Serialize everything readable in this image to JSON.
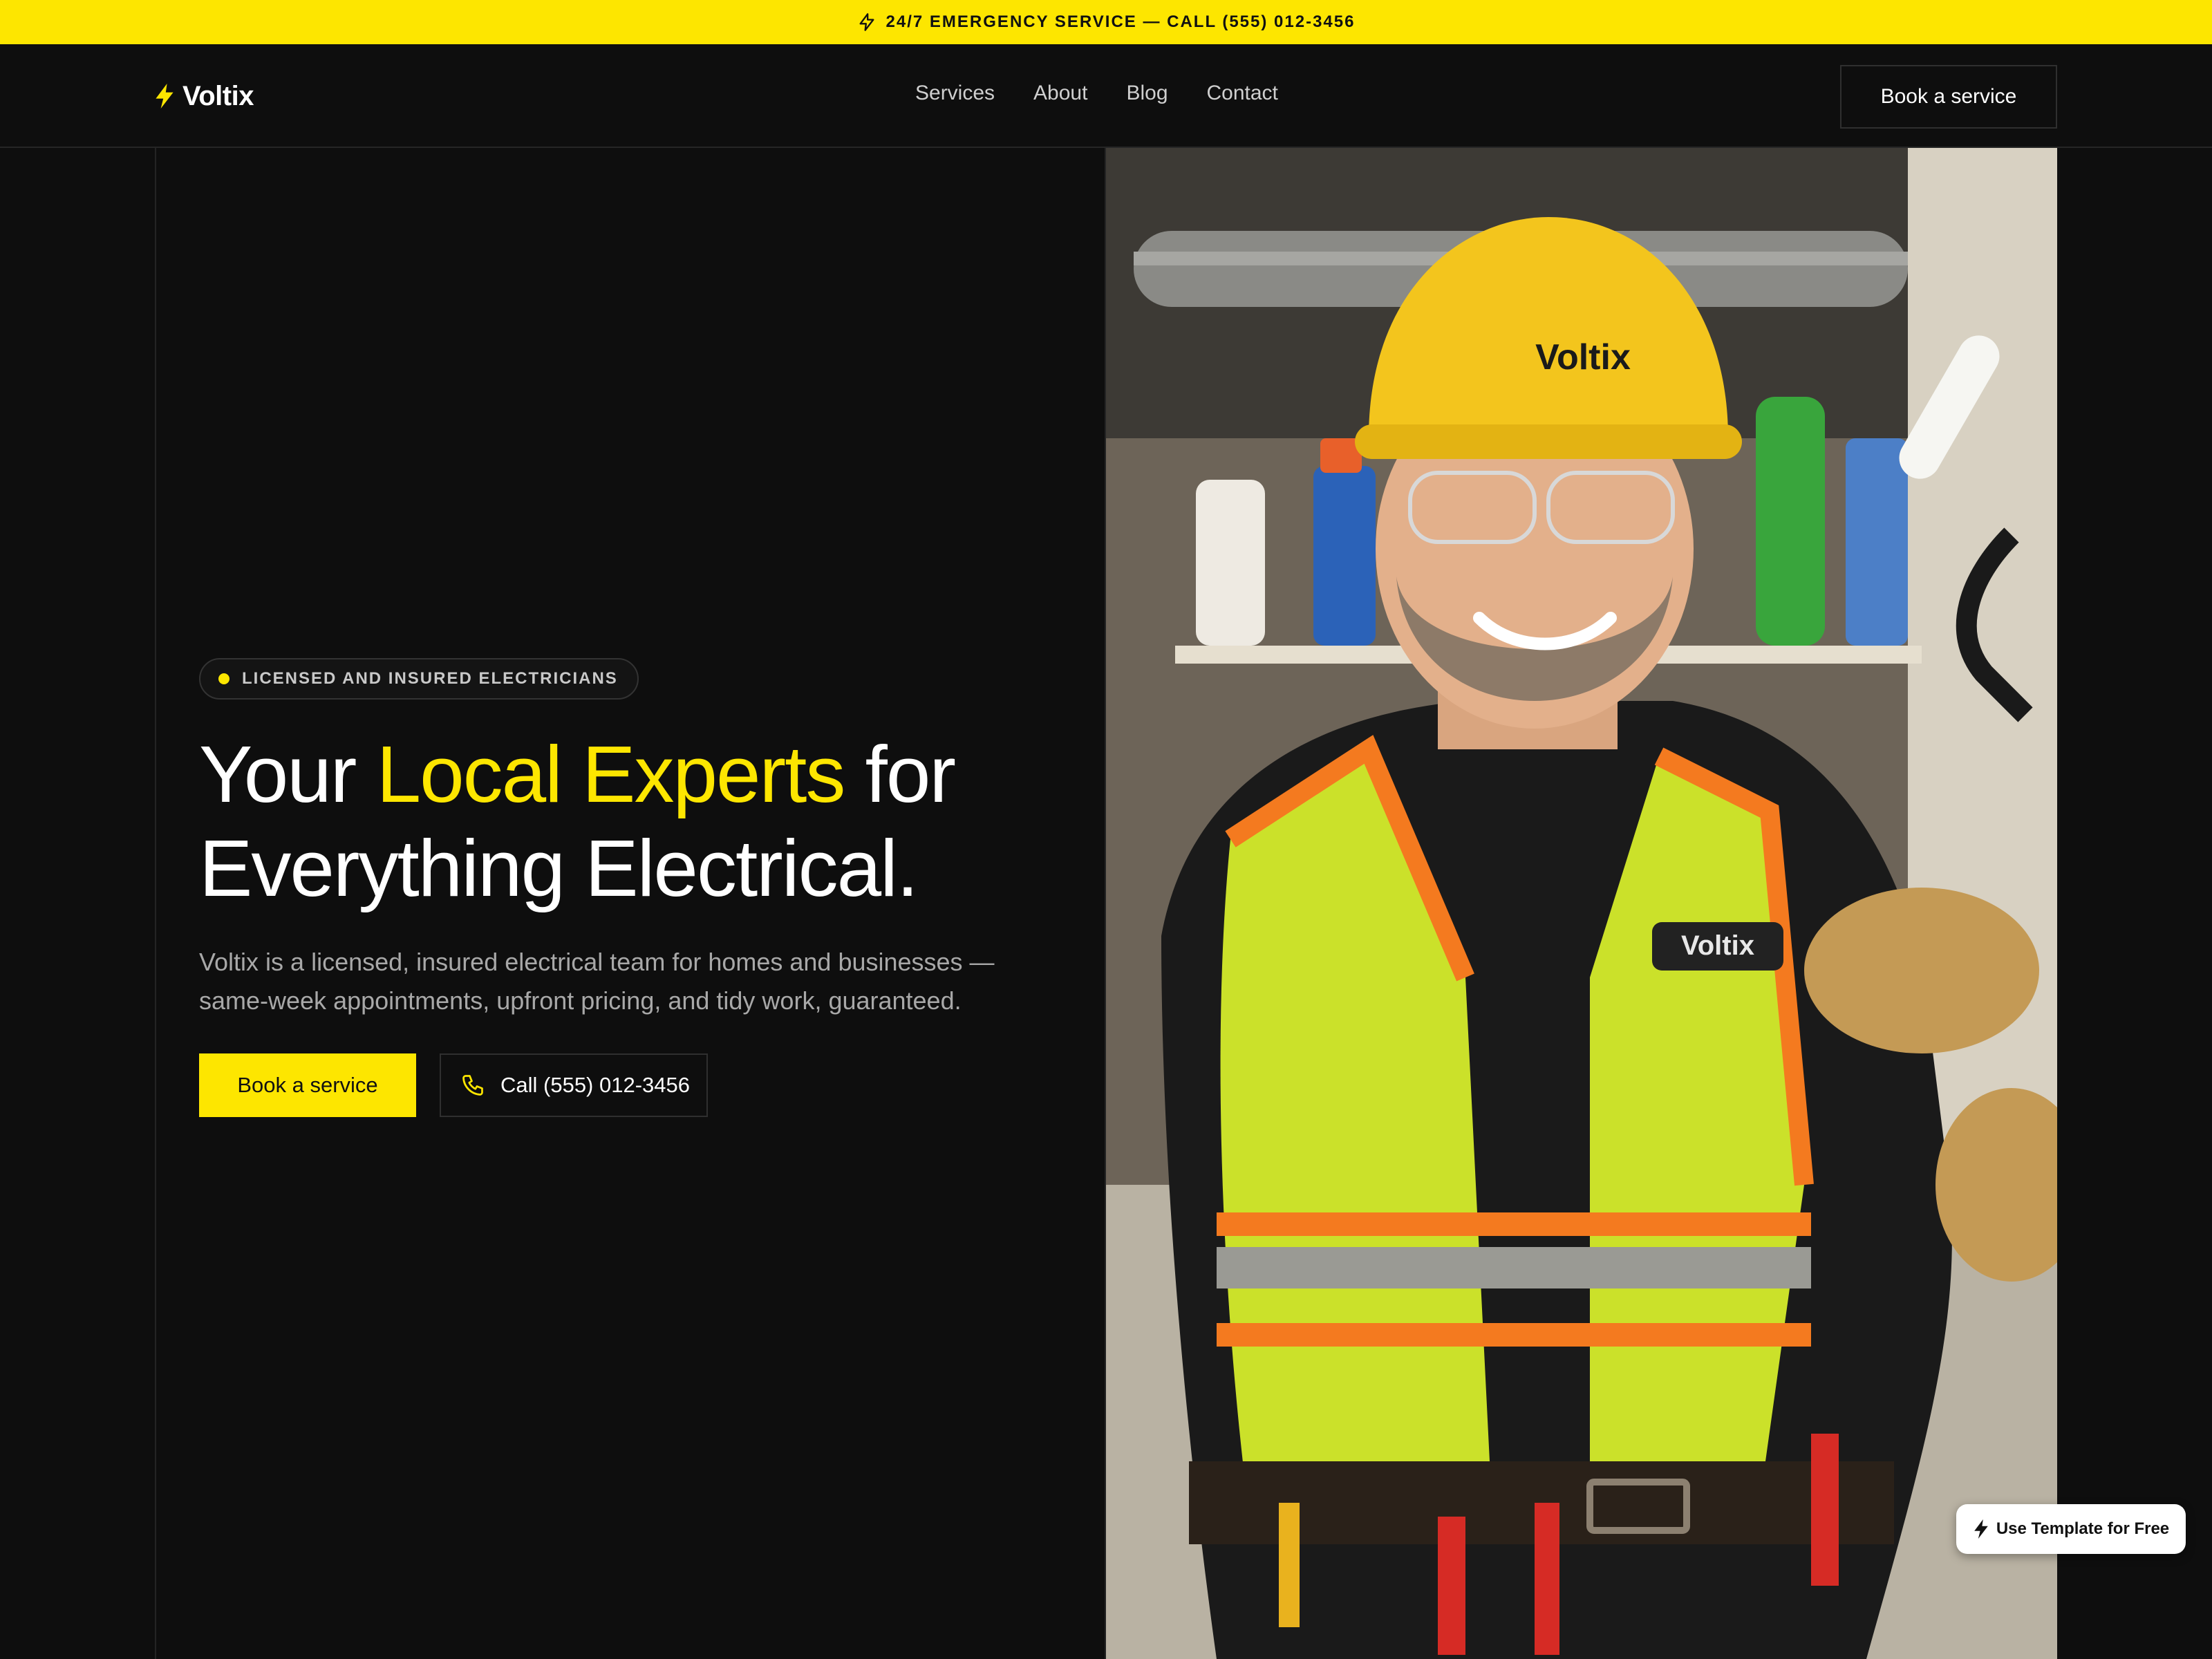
{
  "announcement": {
    "text": "24/7 EMERGENCY SERVICE — CALL (555) 012-3456",
    "icon": "bolt-icon"
  },
  "brand": {
    "name": "Voltix",
    "accent": "#fde600"
  },
  "nav": {
    "items": [
      "Services",
      "About",
      "Blog",
      "Contact"
    ],
    "cta_label": "Book a service"
  },
  "hero": {
    "badge": "LICENSED AND INSURED ELECTRICIANS",
    "headline_pre": "Your ",
    "headline_highlight": "Local Experts",
    "headline_mid": " for",
    "headline_line2": "Everything Electrical.",
    "subtitle": "Voltix is a licensed, insured electrical team for homes and businesses — same-week appointments, upfront pricing, and tidy work, guaranteed.",
    "primary_cta": "Book a service",
    "secondary_cta": "Call (555) 012-3456"
  },
  "photo": {
    "helmet_logo": "Voltix",
    "patch_logo": "Voltix"
  },
  "template_button": {
    "label": "Use Template for Free"
  }
}
